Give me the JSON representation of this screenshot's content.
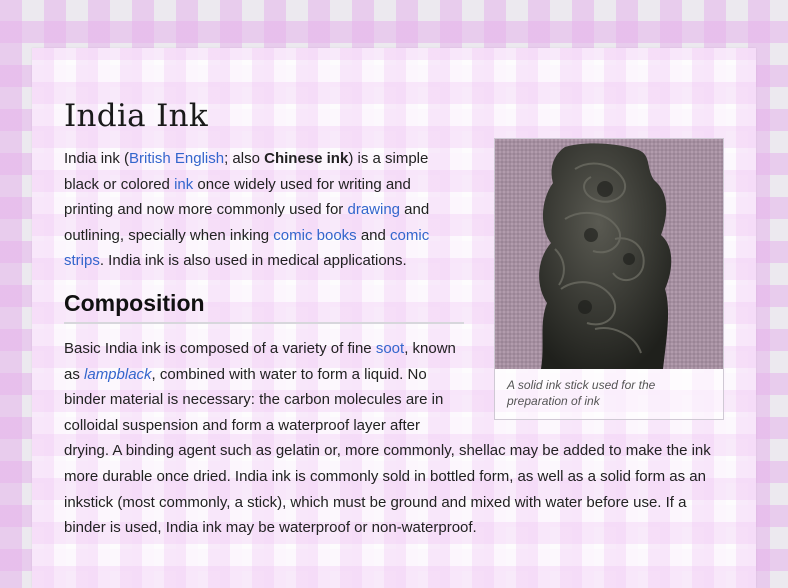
{
  "article": {
    "title": "India Ink",
    "lead": {
      "t1": "India ink (",
      "link_british_english": "British English",
      "t2": "; also ",
      "bold_chinese_ink": "Chinese ink",
      "t3": ") is a simple black or colored ",
      "link_ink": "ink",
      "t4": " once widely used for writing and printing and now more commonly used for ",
      "link_drawing": "drawing",
      "t5": " and outlining, specially when inking ",
      "link_comic_books": "comic books",
      "t6": " and ",
      "link_comic_strips": "comic strips",
      "t7": ". India ink is also used in medical applications."
    },
    "figure": {
      "caption": "A solid ink stick used for the preparation of ink",
      "icon": "ink-stick-image"
    },
    "composition": {
      "heading": "Composition",
      "t1": "Basic India ink is composed of a variety of fine ",
      "link_soot": "soot",
      "t2": ", known as ",
      "link_lampblack": "lampblack",
      "t3": ", combined with water to form a liquid. No binder material is necessary: the carbon molecules are in colloidal suspension and form a waterproof layer after drying. A binding agent such as gelatin or, more commonly, shellac may be added to make the ink more durable once dried. India ink is commonly sold in bottled form, as well as a solid form as an inkstick (most commonly, a stick), which must be ground and mixed with water before use. If a binder is used, India ink may be waterproof or non-waterproof."
    }
  },
  "colors": {
    "link": "#3366cc",
    "text": "#222222",
    "background_check": "#e6b4eb"
  }
}
